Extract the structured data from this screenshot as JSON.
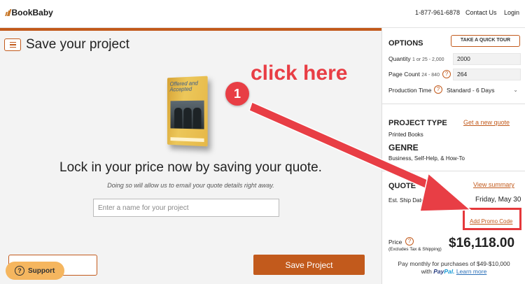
{
  "header": {
    "logo_text": "BookBaby",
    "phone": "1-877-961-6878",
    "contact_label": "Contact Us",
    "login_label": "Login",
    "accent_color": "#c25a1c"
  },
  "main": {
    "title": "Save your project",
    "book_cover_title": "Offered and Accepted",
    "headline": "Lock in your price now by saving your quote.",
    "subtext": "Doing so will allow us to email your quote details right away.",
    "name_placeholder": "Enter a name for your project",
    "save_label": "Save Project",
    "support_label": "Support"
  },
  "options": {
    "heading": "OPTIONS",
    "tour_label": "TAKE A QUICK TOUR",
    "quantity": {
      "label": "Quantity",
      "hint": "1 or 25 - 2,000",
      "value": "2000"
    },
    "page_count": {
      "label": "Page Count",
      "hint": "24 - 840",
      "value": "264"
    },
    "production_time": {
      "label": "Production Time",
      "value": "Standard - 6 Days"
    }
  },
  "project": {
    "type_heading": "PROJECT TYPE",
    "new_quote_label": "Get a new quote",
    "type_value": "Printed Books",
    "genre_heading": "GENRE",
    "genre_value": "Business, Self-Help, & How-To"
  },
  "quote": {
    "heading": "QUOTE",
    "view_summary_label": "View summary",
    "ship_label": "Est. Ship Date",
    "ship_value": "Friday, May 30",
    "promo_label": "Add Promo Code",
    "price_label": "Price",
    "price_note": "(Excludes Tax & Shipping)",
    "price_value": "$16,118.00",
    "paypal_text_1": "Pay monthly for purchases of $49-$10,000",
    "paypal_with": "with",
    "paypal_brand_a": "Pay",
    "paypal_brand_b": "Pal.",
    "learn_more_label": "Learn more"
  },
  "annotation": {
    "text": "click here",
    "badge": "1",
    "color": "#e83e45"
  }
}
